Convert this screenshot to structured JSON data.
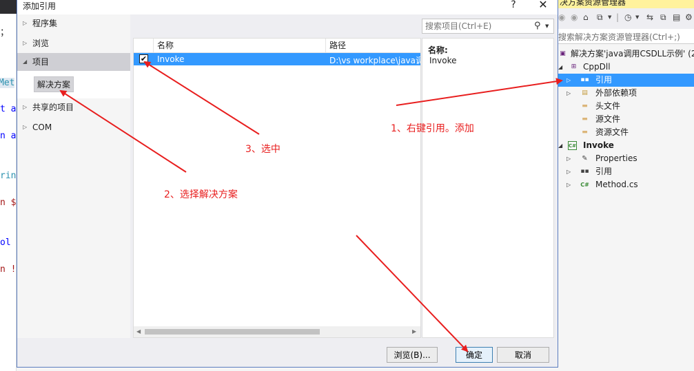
{
  "editor": {
    "lines": [
      "；",
      "Met",
      "t a",
      "n a",
      "rin",
      "n $",
      "ol",
      "n !"
    ]
  },
  "dialog": {
    "title": "添加引用",
    "help_glyph": "?",
    "close_glyph": "✕",
    "nav": {
      "assemblies": "程序集",
      "browse": "浏览",
      "projects": "项目",
      "solution": "解决方案",
      "shared_projects": "共享的项目",
      "com": "COM"
    },
    "search": {
      "placeholder": "搜索项目(Ctrl+E)"
    },
    "list": {
      "columns": [
        "名称",
        "路径"
      ],
      "rows": [
        {
          "checked": true,
          "name": "Invoke",
          "path": "D:\\vs workplace\\java调"
        }
      ]
    },
    "details": {
      "name_label": "名称:",
      "name_value": "Invoke"
    },
    "buttons": {
      "browse": "浏览(B)...",
      "ok": "确定",
      "cancel": "取消"
    }
  },
  "solution_explorer": {
    "title": "决方案资源管理器",
    "search_placeholder": "搜索解决方案资源管理器(Ctrl+;)",
    "tree": [
      {
        "label": "解决方案'java调用CSDLL示例' (2",
        "icon": "solution-icon",
        "glyph": "▣"
      },
      {
        "label": "CppDll",
        "icon": "cpp-project-icon",
        "glyph": "⊞"
      },
      {
        "label": "引用",
        "icon": "references-icon",
        "glyph": "▪▪"
      },
      {
        "label": "外部依赖项",
        "icon": "external-deps-icon",
        "glyph": "▤"
      },
      {
        "label": "头文件",
        "icon": "folder-icon",
        "glyph": "▬"
      },
      {
        "label": "源文件",
        "icon": "folder-icon",
        "glyph": "▬"
      },
      {
        "label": "资源文件",
        "icon": "folder-icon",
        "glyph": "▬"
      },
      {
        "label": "Invoke",
        "icon": "csharp-project-icon",
        "glyph": "C#"
      },
      {
        "label": "Properties",
        "icon": "wrench-icon",
        "glyph": "🔧"
      },
      {
        "label": "引用",
        "icon": "references-icon",
        "glyph": "▪▪"
      },
      {
        "label": "Method.cs",
        "icon": "csharp-file-icon",
        "glyph": "C#"
      }
    ]
  },
  "annotations": [
    {
      "text": "1、右键引用。添加"
    },
    {
      "text": "2、选择解决方案"
    },
    {
      "text": "3、选中"
    }
  ],
  "colors": {
    "selection": "#3399ff",
    "annotation": "#e81e1e",
    "se_title_bg": "#fff29d"
  }
}
